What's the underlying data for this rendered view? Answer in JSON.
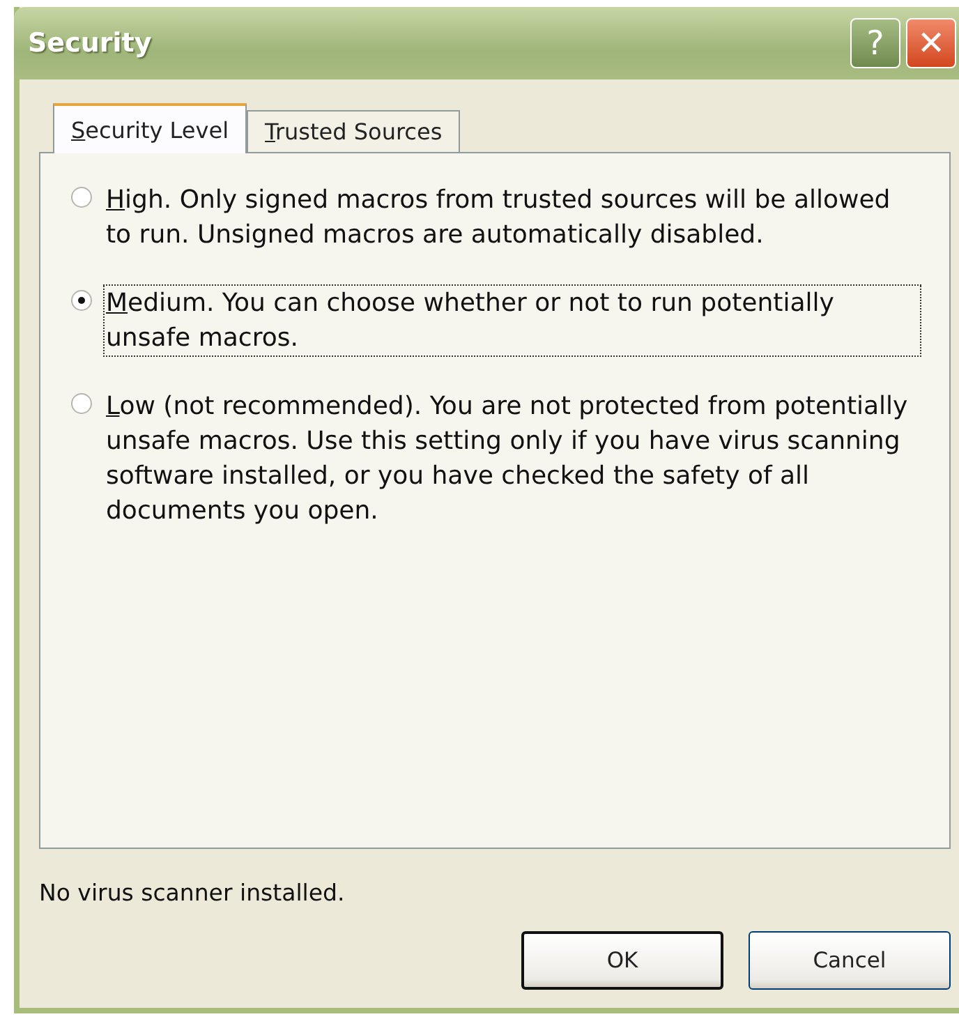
{
  "window": {
    "title": "Security",
    "help_button": "?",
    "close_button": "✕"
  },
  "tabs": [
    {
      "label": "Security Level",
      "selected": true
    },
    {
      "label": "Trusted Sources",
      "selected": false
    }
  ],
  "options": [
    {
      "label": "High. Only signed macros from trusted sources will be allowed to run. Unsigned macros are automatically disabled.",
      "selected": false,
      "focused": false
    },
    {
      "label": "Medium. You can choose whether or not to run potentially unsafe macros.",
      "selected": true,
      "focused": true
    },
    {
      "label": "Low (not recommended). You are not protected from potentially unsafe macros. Use this setting only if you have virus scanning software installed, or you have checked the safety of all documents you open.",
      "selected": false,
      "focused": false
    }
  ],
  "status": "No virus scanner installed.",
  "buttons": [
    {
      "label": "OK",
      "default": true
    },
    {
      "label": "Cancel",
      "default": false
    }
  ]
}
